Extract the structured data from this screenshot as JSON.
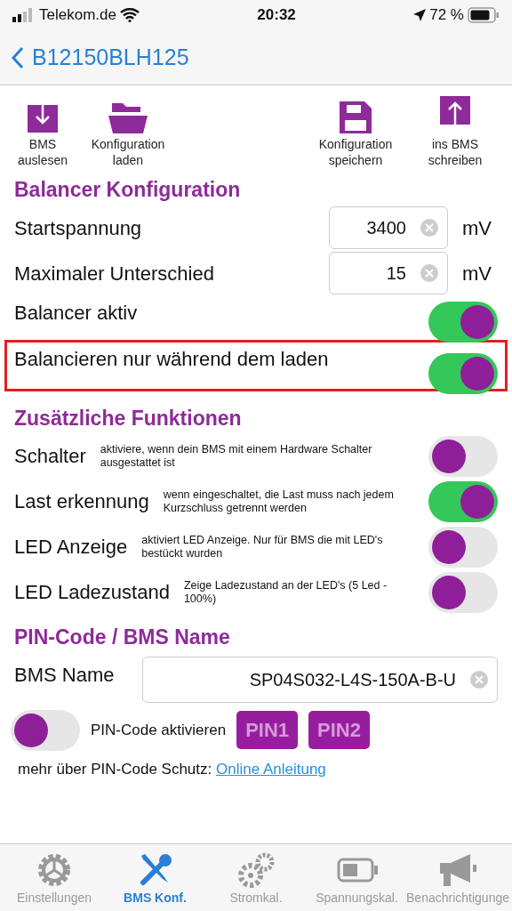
{
  "status_bar": {
    "carrier": "Telekom.de",
    "time": "20:32",
    "battery": "72 %"
  },
  "nav": {
    "title": "B12150BLH125"
  },
  "actions": [
    {
      "kind": "download",
      "label": "BMS auslesen"
    },
    {
      "kind": "folder",
      "label": "Konfiguration laden"
    },
    {
      "kind": "save",
      "label": "Konfiguration speichern"
    },
    {
      "kind": "upload",
      "label": "ins BMS schreiben"
    }
  ],
  "balancer": {
    "title": "Balancer Konfiguration",
    "rows": [
      {
        "kind": "input",
        "label": "Startspannung",
        "value": "3400",
        "unit": "mV"
      },
      {
        "kind": "input",
        "label": "Maximaler Unterschied",
        "value": "15",
        "unit": "mV"
      },
      {
        "kind": "toggle",
        "label": "Balancer aktiv",
        "on": true,
        "highlighted": false
      },
      {
        "kind": "toggle",
        "label": "Balancieren nur während dem laden",
        "on": true,
        "highlighted": true
      }
    ]
  },
  "functions": {
    "title": "Zusätzliche Funktionen",
    "rows": [
      {
        "label": "Schalter",
        "description": "aktiviere, wenn dein BMS mit einem Hardware Schalter ausgestattet ist",
        "on": false
      },
      {
        "label": "Last erkennung",
        "description": "wenn eingeschaltet, die Last muss nach jedem Kurzschluss getrennt werden",
        "on": true
      },
      {
        "label": "LED Anzeige",
        "description": "aktiviert LED Anzeige. Nur für BMS die mit LED's bestückt wurden",
        "on": false
      },
      {
        "label": "LED Ladezustand",
        "description": "Zeige Ladezustand an der LED's (5 Led - 100%)",
        "on": false
      }
    ]
  },
  "pin": {
    "title": "PIN-Code / BMS Name",
    "name_label": "BMS Name",
    "name_value": "SP04S032-L4S-150A-B-U",
    "toggle_on": false,
    "toggle_label": "PIN-Code aktivieren",
    "buttons": [
      "PIN1",
      "PIN2"
    ],
    "more_text": "mehr über PIN-Code Schutz:",
    "link": "Online Anleitung"
  },
  "tabs": [
    {
      "kind": "gear",
      "label": "Einstellungen",
      "selected": false
    },
    {
      "kind": "tools",
      "label": "BMS Konf.",
      "selected": true
    },
    {
      "kind": "gears",
      "label": "Stromkal.",
      "selected": false
    },
    {
      "kind": "battery",
      "label": "Spannungskal.",
      "selected": false
    },
    {
      "kind": "megaphone",
      "label": "Benachrichtigunge",
      "selected": false
    }
  ]
}
